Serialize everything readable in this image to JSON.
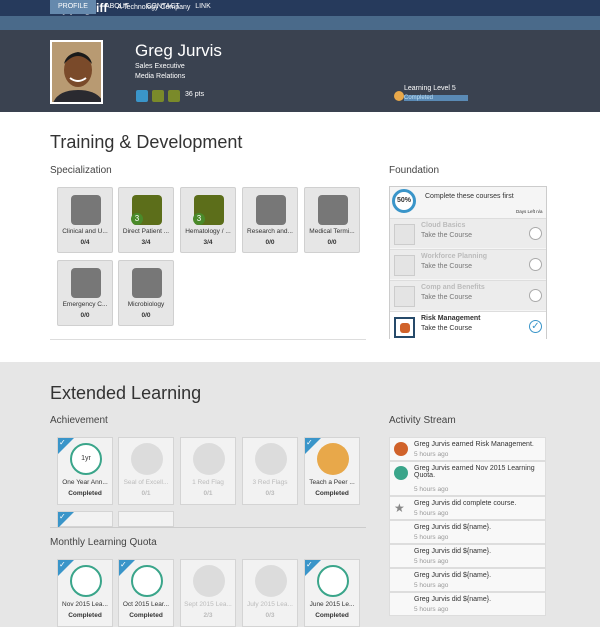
{
  "brand": {
    "name": "Hippogriff",
    "tagline": "A Technology Company"
  },
  "nav": [
    {
      "label": "PROFILE",
      "active": true
    },
    {
      "label": "ABOUT"
    },
    {
      "label": "CONTACT"
    },
    {
      "label": "LINK"
    }
  ],
  "profile": {
    "name": "Greg Jurvis",
    "title": "Sales Executive",
    "department": "Media Relations",
    "points": "36 pts",
    "level_label": "Learning Level 5",
    "level_status": "Completed"
  },
  "training": {
    "title": "Training & Development",
    "specialization_title": "Specialization",
    "specialization": [
      {
        "label": "Clinical and U...",
        "value": "0/4"
      },
      {
        "label": "Direct Patient ...",
        "value": "3/4",
        "badge": "3"
      },
      {
        "label": "Hematology / ...",
        "value": "3/4",
        "badge": "3"
      },
      {
        "label": "Research and...",
        "value": "0/0"
      },
      {
        "label": "Medical Termi...",
        "value": "0/0"
      },
      {
        "label": "Emergency C...",
        "value": "0/0"
      },
      {
        "label": "Microbiology",
        "value": "0/0"
      }
    ],
    "foundation_title": "Foundation",
    "foundation": {
      "progress": "50%",
      "heading": "Complete these courses first",
      "days": "Days Left n/a",
      "courses": [
        {
          "name": "Cloud Basics",
          "action": "Take the Course"
        },
        {
          "name": "Workforce Planning",
          "action": "Take the Course"
        },
        {
          "name": "Comp and Benefits",
          "action": "Take the Course"
        },
        {
          "name": "Risk Management",
          "action": "Take the Course"
        }
      ]
    }
  },
  "extended": {
    "title": "Extended Learning",
    "achievement_title": "Achievement",
    "achievements": [
      {
        "label": "One Year Ann...",
        "value": "Completed",
        "icon_text": "1yr"
      },
      {
        "label": "Seal of Excell...",
        "value": "0/1"
      },
      {
        "label": "1 Red Flag",
        "value": "0/1"
      },
      {
        "label": "3 Red Flags",
        "value": "0/3"
      },
      {
        "label": "Teach a Peer ...",
        "value": "Completed"
      }
    ],
    "quota_title": "Monthly Learning Quota",
    "quotas": [
      {
        "label": "Nov 2015 Lea...",
        "value": "Completed"
      },
      {
        "label": "Oct 2015 Lear...",
        "value": "Completed"
      },
      {
        "label": "Sept 2015 Lea...",
        "value": "2/3"
      },
      {
        "label": "July 2015 Lea...",
        "value": "0/3"
      },
      {
        "label": "June 2015 Le...",
        "value": "Completed"
      }
    ],
    "activity_title": "Activity Stream",
    "activity": [
      {
        "text": "Greg Jurvis earned Risk Management.",
        "time": "5 hours ago"
      },
      {
        "text": "Greg Jurvis earned Nov 2015 Learning Quota.",
        "time": "5 hours ago"
      },
      {
        "text": "Greg Jurvis did complete course.",
        "time": "5 hours ago"
      },
      {
        "text": "Greg Jurvis did ${name}.",
        "time": "5 hours ago"
      },
      {
        "text": "Greg Jurvis did ${name}.",
        "time": "5 hours ago"
      },
      {
        "text": "Greg Jurvis did ${name}.",
        "time": "5 hours ago"
      },
      {
        "text": "Greg Jurvis did ${name}.",
        "time": "5 hours ago"
      }
    ]
  },
  "colors": {
    "topbar": "#263a5c",
    "nav": "#4a6a8a",
    "header": "#3a4250",
    "accent": "#3a95c9",
    "green": "#5c6e1a"
  }
}
